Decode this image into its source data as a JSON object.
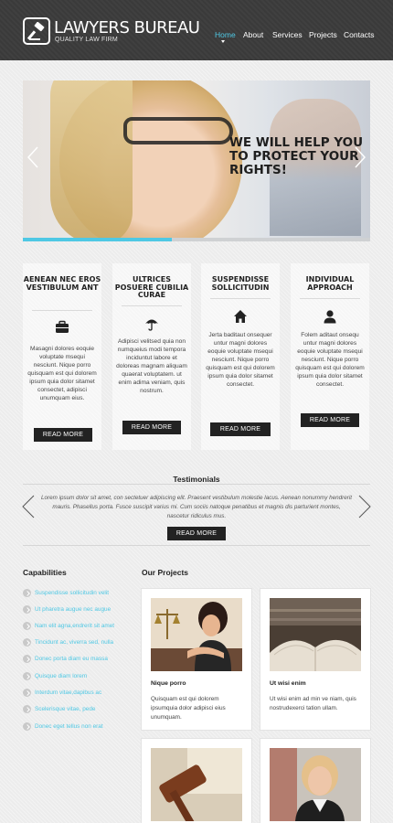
{
  "header": {
    "brand": "LAWYERS BUREAU",
    "tagline": "QUALITY LAW FIRM",
    "logo_icon": "gavel-icon",
    "nav": [
      "Home",
      "About",
      "Services",
      "Projects",
      "Contacts"
    ],
    "active_nav": "Home",
    "accent_color": "#4fc8e4"
  },
  "slider": {
    "headline": "WE WILL HELP YOU TO PROTECT YOUR RIGHTS!",
    "progress": 0.43
  },
  "features": [
    {
      "title": "AENEAN NEC EROS VESTIBULUM ANT",
      "icon": "briefcase-icon",
      "text": "Masagni dolores eoquie voluptate msequi nesciunt. Nique porro quisquam est qui dolorem ipsum quia dolor sitamet consectet, adipisci unumquam eius.",
      "button": "READ MORE"
    },
    {
      "title": "ULTRICES POSUERE CUBILIA CURAE",
      "icon": "umbrella-icon",
      "text": "Adipisci velitsed quia non numqueius modi tempora inciduntut labore et doloreas magnam aliquam quaerat voluptatem. ut enim adima veniam, quis nostrum.",
      "button": "READ MORE"
    },
    {
      "title": "SUSPENDISSE SOLLICITUDIN",
      "icon": "home-icon",
      "text": "Jerta baditaut onsequer untur magni dolores eoquie voluptate msequi nesciunt. Nique porro quisquam est qui dolorem ipsum quia dolor sitamet consectet.",
      "button": "READ MORE"
    },
    {
      "title": "INDIVIDUAL APPROACH",
      "icon": "user-icon",
      "text": "Folem aditaut onsequ untur magni dolores eoquie voluptate msequi nesciunt. Nique porro quisquam est qui dolorem ipsum quia dolor sitamet consectet.",
      "button": "READ MORE"
    }
  ],
  "testimonials": {
    "title": "Testimonials",
    "quote": "Lorem ipsum dolor sit amet, con sectetuer adipiscing elit. Praesent vestibulum molestie lacus. Aenean nonummy hendrerit mauris. Phasellus porta. Fusce suscipit varius mi. Cum sociis natoque penatibus et magnis dis parturient montes, nascetur ridiculus mus.",
    "button": "READ MORE"
  },
  "capabilities": {
    "title": "Capabilities",
    "items": [
      "Suspendisse sollicitudin velit",
      "Ut pharetra augue nec augue",
      "Nam elit agna,endrerit sit amet",
      "Tincidunt ac, viverra sed, nulla",
      "Donec porta diam eu massa",
      "Quisque diam lorem",
      "Interdum vitae,dapibus ac",
      "Scelerisque vitae, pede",
      "Donec eget tellus non erat"
    ]
  },
  "projects": {
    "title": "Our Projects",
    "items": [
      {
        "name": "Nique porro",
        "desc": "Quisquam est qui dolorem ipsumquia dolor adipisci eius unumquam."
      },
      {
        "name": "Ut wisi enim",
        "desc": "Ut wisi enim ad min ve niam, quis nostrudexerci tation ullam."
      },
      {
        "name": "",
        "desc": ""
      },
      {
        "name": "",
        "desc": ""
      }
    ]
  }
}
